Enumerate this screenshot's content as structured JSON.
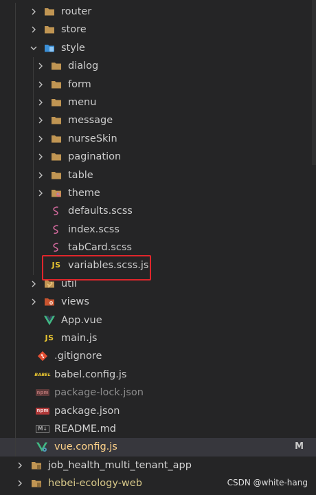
{
  "explorer": {
    "items": [
      {
        "label": "router",
        "icon": "folder-icon",
        "chevron": "right"
      },
      {
        "label": "store",
        "icon": "folder-icon",
        "chevron": "right"
      },
      {
        "label": "style",
        "icon": "folder-style-icon",
        "chevron": "down"
      },
      {
        "label": "dialog",
        "icon": "folder-icon",
        "chevron": "right"
      },
      {
        "label": "form",
        "icon": "folder-icon",
        "chevron": "right"
      },
      {
        "label": "menu",
        "icon": "folder-icon",
        "chevron": "right"
      },
      {
        "label": "message",
        "icon": "folder-icon",
        "chevron": "right"
      },
      {
        "label": "nurseSkin",
        "icon": "folder-icon",
        "chevron": "right"
      },
      {
        "label": "pagination",
        "icon": "folder-icon",
        "chevron": "right"
      },
      {
        "label": "table",
        "icon": "folder-icon",
        "chevron": "right"
      },
      {
        "label": "theme",
        "icon": "folder-theme-icon",
        "chevron": "right"
      },
      {
        "label": "defaults.scss",
        "icon": "scss-icon"
      },
      {
        "label": "index.scss",
        "icon": "scss-icon"
      },
      {
        "label": "tabCard.scss",
        "icon": "scss-icon"
      },
      {
        "label": "variables.scss.js",
        "icon": "js-icon",
        "icon_text": "JS"
      },
      {
        "label": "util",
        "icon": "folder-util-icon",
        "chevron": "right"
      },
      {
        "label": "views",
        "icon": "folder-views-icon",
        "chevron": "right"
      },
      {
        "label": "App.vue",
        "icon": "vue-icon"
      },
      {
        "label": "main.js",
        "icon": "js-icon",
        "icon_text": "JS"
      },
      {
        "label": ".gitignore",
        "icon": "git-icon"
      },
      {
        "label": "babel.config.js",
        "icon": "babel-icon",
        "icon_text": "BABEL"
      },
      {
        "label": "package-lock.json",
        "icon": "npm-icon",
        "icon_text": "npm"
      },
      {
        "label": "package.json",
        "icon": "npm-icon",
        "icon_text": "npm"
      },
      {
        "label": "README.md",
        "icon": "markdown-icon",
        "icon_text": "M↓"
      },
      {
        "label": "vue.config.js",
        "icon": "vue-config-icon",
        "status": "M"
      },
      {
        "label": "job_health_multi_tenant_app",
        "icon": "folder-icon",
        "chevron": "right"
      },
      {
        "label": "hebei-ecology-web",
        "icon": "folder-icon",
        "chevron": "right"
      }
    ]
  },
  "watermark": "CSDN @white-hang",
  "colors": {
    "background": "#252526",
    "selected_row": "#37373d",
    "highlight_border": "#e0262b",
    "folder": "#c09553",
    "scss": "#cd6799",
    "js": "#e8c531",
    "vue": "#41b883"
  }
}
